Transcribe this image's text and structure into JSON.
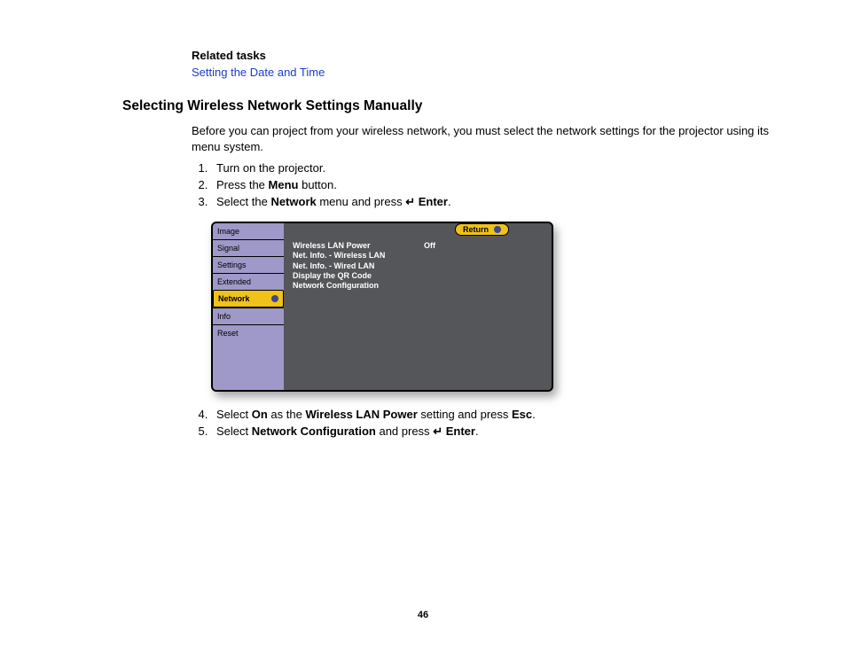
{
  "related": {
    "heading": "Related tasks",
    "link": "Setting the Date and Time"
  },
  "section_title": "Selecting Wireless Network Settings Manually",
  "intro": "Before you can project from your wireless network, you must select the network settings for the projector using its menu system.",
  "steps": {
    "s1": "Turn on the projector.",
    "s2_a": "Press the ",
    "s2_b": "Menu",
    "s2_c": " button.",
    "s3_a": "Select the ",
    "s3_b": "Network",
    "s3_c": " menu and press ",
    "s3_d": " Enter",
    "s3_e": ".",
    "s4_a": "Select ",
    "s4_b": "On",
    "s4_c": " as the ",
    "s4_d": "Wireless LAN Power",
    "s4_e": " setting and press ",
    "s4_f": "Esc",
    "s4_g": ".",
    "s5_a": "Select ",
    "s5_b": "Network Configuration",
    "s5_c": " and press ",
    "s5_d": " Enter",
    "s5_e": "."
  },
  "menu": {
    "sidebar": [
      "Image",
      "Signal",
      "Settings",
      "Extended",
      "Network",
      "Info",
      "Reset"
    ],
    "return": "Return",
    "options": [
      {
        "label": "Wireless LAN Power",
        "value": "Off"
      },
      {
        "label": "Net. Info. - Wireless LAN",
        "value": ""
      },
      {
        "label": "Net. Info. - Wired LAN",
        "value": ""
      },
      {
        "label": "Display the QR Code",
        "value": ""
      },
      {
        "label": "Network Configuration",
        "value": ""
      }
    ]
  },
  "page_number": "46",
  "enter_glyph": "↵"
}
